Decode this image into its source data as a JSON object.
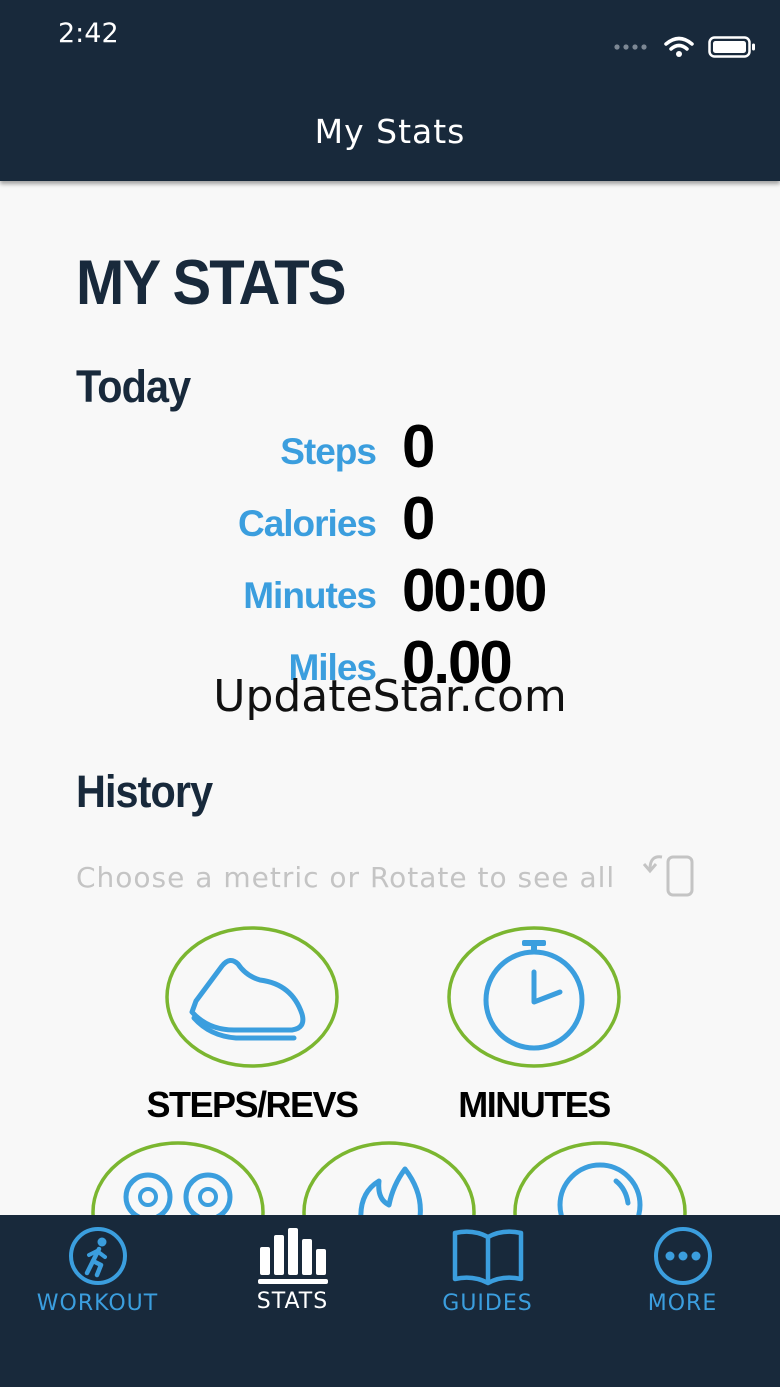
{
  "status_bar": {
    "time": "2:42"
  },
  "nav": {
    "title": "My Stats"
  },
  "page": {
    "title": "MY STATS"
  },
  "today": {
    "heading": "Today",
    "stats": [
      {
        "label": "Steps",
        "value": "0"
      },
      {
        "label": "Calories",
        "value": "0"
      },
      {
        "label": "Minutes",
        "value": "00:00"
      },
      {
        "label": "Miles",
        "value": "0.00"
      }
    ]
  },
  "watermark": "UpdateStar.com",
  "history": {
    "heading": "History",
    "hint": "Choose a metric or Rotate to see all",
    "metrics": [
      {
        "label": "STEPS/REVS",
        "icon": "shoe-icon"
      },
      {
        "label": "MINUTES",
        "icon": "stopwatch-icon"
      },
      {
        "label": "",
        "icon": "odometer-icon"
      },
      {
        "label": "",
        "icon": "flame-icon"
      },
      {
        "label": "",
        "icon": "distance-icon"
      }
    ]
  },
  "tabs": [
    {
      "label": "WORKOUT",
      "icon": "walker-icon",
      "active": false
    },
    {
      "label": "STATS",
      "icon": "bar-chart-icon",
      "active": true
    },
    {
      "label": "GUIDES",
      "icon": "book-icon",
      "active": false
    },
    {
      "label": "MORE",
      "icon": "ellipsis-icon",
      "active": false
    }
  ],
  "colors": {
    "navy": "#18293b",
    "accent_blue": "#3b9ede",
    "ring_green": "#7bb630",
    "background": "#f8f8f8"
  }
}
